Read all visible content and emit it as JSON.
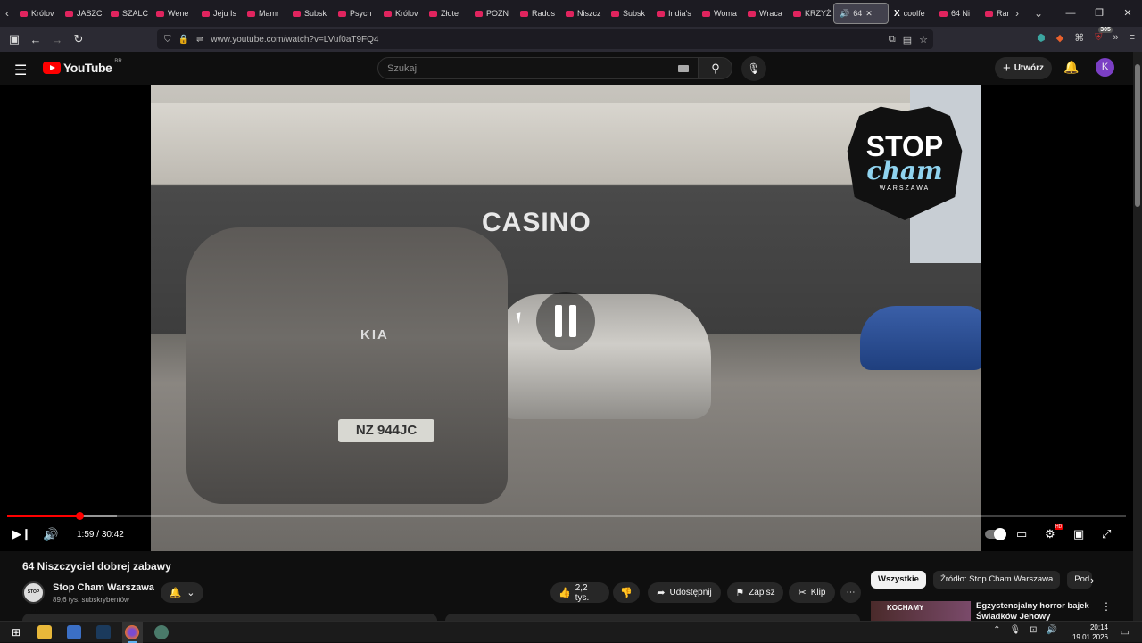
{
  "browser": {
    "tabs": [
      "Królov",
      "JASZC",
      "SZALC",
      "Wene",
      "Jeju Is",
      "Mamr",
      "Subsk",
      "Psych",
      "Królov",
      "Złote",
      "POZN",
      "Rados",
      "Niszcz",
      "Subsk",
      "India's",
      "Woma",
      "Wraca",
      "KRZYŻ"
    ],
    "active_tab": {
      "label": "64 ",
      "audio_icon": "speaker-icon"
    },
    "x_tab": "coolfe",
    "extra_tabs": [
      "64 Ni",
      "Ran"
    ],
    "url": "www.youtube.com/watch?v=LVuf0aT9FQ4",
    "extension_badge": "305"
  },
  "youtube": {
    "logo_text": "YouTube",
    "country_code": "BR",
    "search_placeholder": "Szukaj",
    "create_label": "Utwórz",
    "avatar_letter": "K"
  },
  "player": {
    "current_time": "1:59",
    "duration": "30:42",
    "played_fraction": 0.0647,
    "loaded_fraction": 0.098,
    "state": "paused-overlay",
    "hd_badge": "HD",
    "video_scene": {
      "casino_sign": "CASINO",
      "plate": "NZ 944JC",
      "car_brand": "KIA",
      "channel_logo": {
        "line1": "STOP",
        "line2": "cham",
        "line3": "WARSZAWA"
      }
    }
  },
  "video_info": {
    "title": "64 Niszczyciel dobrej zabawy",
    "channel_name": "Stop Cham Warszawa",
    "channel_avatar_text": "STOP cham",
    "subscribers": "89,6 tys. subskrybentów",
    "likes": "2,2 tys.",
    "share_label": "Udostępnij",
    "save_label": "Zapisz",
    "clip_label": "Klip"
  },
  "recommendations": {
    "chips": [
      "Wszystkie",
      "Źródło: Stop Cham Warszawa",
      "Pod"
    ],
    "first_item": {
      "thumb_text": "KOCHAMY",
      "title": "Egzystencjalny horror bajek Świadków Jehowy"
    }
  },
  "taskbar": {
    "time": "20:14",
    "date": "19.01.2026"
  }
}
